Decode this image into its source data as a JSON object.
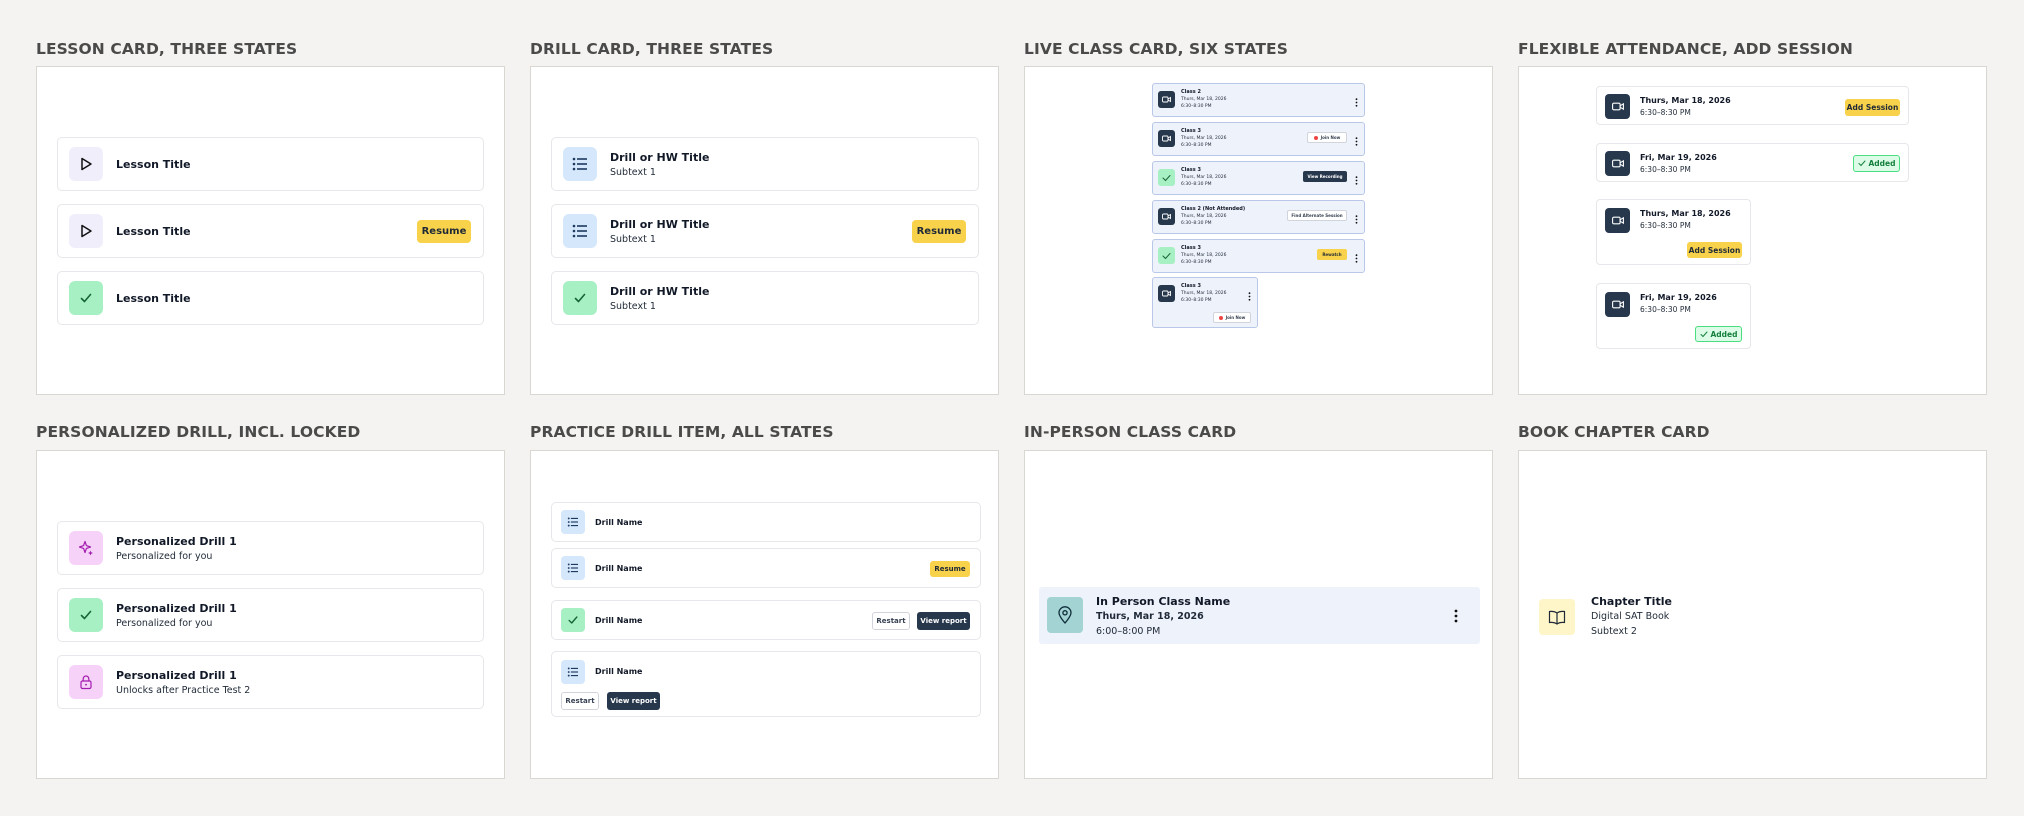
{
  "sections": {
    "lesson": "LESSON CARD, THREE STATES",
    "drill": "DRILL CARD, THREE STATES",
    "live": "LIVE CLASS CARD, SIX STATES",
    "flex": "FLEXIBLE ATTENDANCE, ADD SESSION",
    "personalized": "PERSONALIZED DRILL, INCL. LOCKED",
    "practice": "PRACTICE DRILL ITEM, ALL STATES",
    "inperson": "IN-PERSON CLASS CARD",
    "book": "BOOK CHAPTER CARD"
  },
  "lesson": {
    "items": [
      {
        "title": "Lesson Title"
      },
      {
        "title": "Lesson Title",
        "button": "Resume"
      },
      {
        "title": "Lesson Title"
      }
    ]
  },
  "drill": {
    "items": [
      {
        "title": "Drill or HW Title",
        "subtitle": "Subtext 1"
      },
      {
        "title": "Drill or HW Title",
        "subtitle": "Subtext 1",
        "button": "Resume"
      },
      {
        "title": "Drill or HW Title",
        "subtitle": "Subtext 1"
      }
    ]
  },
  "live": {
    "items": [
      {
        "title": "Class 2",
        "date": "Thurs, Mar 18, 2026",
        "time": "6:30–8:30 PM"
      },
      {
        "title": "Class 3",
        "date": "Thurs, Mar 18, 2026",
        "time": "6:30–8:30 PM",
        "button": "Join Now"
      },
      {
        "title": "Class 3",
        "date": "Thurs, Mar 18, 2026",
        "time": "6:30–8:30 PM",
        "button": "View Recording"
      },
      {
        "title": "Class 2 (Not Attended)",
        "date": "Thurs, Mar 18, 2026",
        "time": "6:30–8:30 PM",
        "button": "Find Alternate Session"
      },
      {
        "title": "Class 3",
        "date": "Thurs, Mar 18, 2026",
        "time": "6:30–8:30 PM",
        "button": "Rewatch"
      },
      {
        "title": "Class 3",
        "date": "Thurs, Mar 18, 2026",
        "time": "6:30–8:30 PM",
        "button": "Join Now"
      }
    ]
  },
  "flex": {
    "items": [
      {
        "date": "Thurs, Mar 18, 2026",
        "time": "6:30–8:30 PM",
        "button": "Add Session"
      },
      {
        "date": "Fri, Mar 19, 2026",
        "time": "6:30–8:30 PM",
        "button": "Added"
      },
      {
        "date": "Thurs, Mar 18, 2026",
        "time": "6:30–8:30 PM",
        "button": "Add Session"
      },
      {
        "date": "Fri, Mar 19, 2026",
        "time": "6:30–8:30 PM",
        "button": "Added"
      }
    ]
  },
  "personalized": {
    "items": [
      {
        "title": "Personalized Drill 1",
        "subtitle": "Personalized for you"
      },
      {
        "title": "Personalized Drill 1",
        "subtitle": "Personalized for you"
      },
      {
        "title": "Personalized Drill 1",
        "subtitle": "Unlocks after Practice Test 2"
      }
    ]
  },
  "practice": {
    "items": [
      {
        "title": "Drill Name"
      },
      {
        "title": "Drill Name",
        "button": "Resume"
      },
      {
        "title": "Drill Name",
        "restart": "Restart",
        "report": "View report"
      },
      {
        "title": "Drill Name",
        "restart": "Restart",
        "report": "View report"
      }
    ]
  },
  "inperson": {
    "title": "In Person Class Name",
    "date": "Thurs, Mar 18, 2026",
    "time": "6:00–8:00 PM"
  },
  "book": {
    "title": "Chapter Title",
    "subtitle": "Digital SAT Book",
    "subtext": "Subtext 2"
  },
  "colors": {
    "background": "#f4f3f1",
    "accent_yellow": "#f8d24a",
    "navy": "#27384d",
    "success_green": "#a7f0c4",
    "live_card_bg": "#eef2fb"
  }
}
